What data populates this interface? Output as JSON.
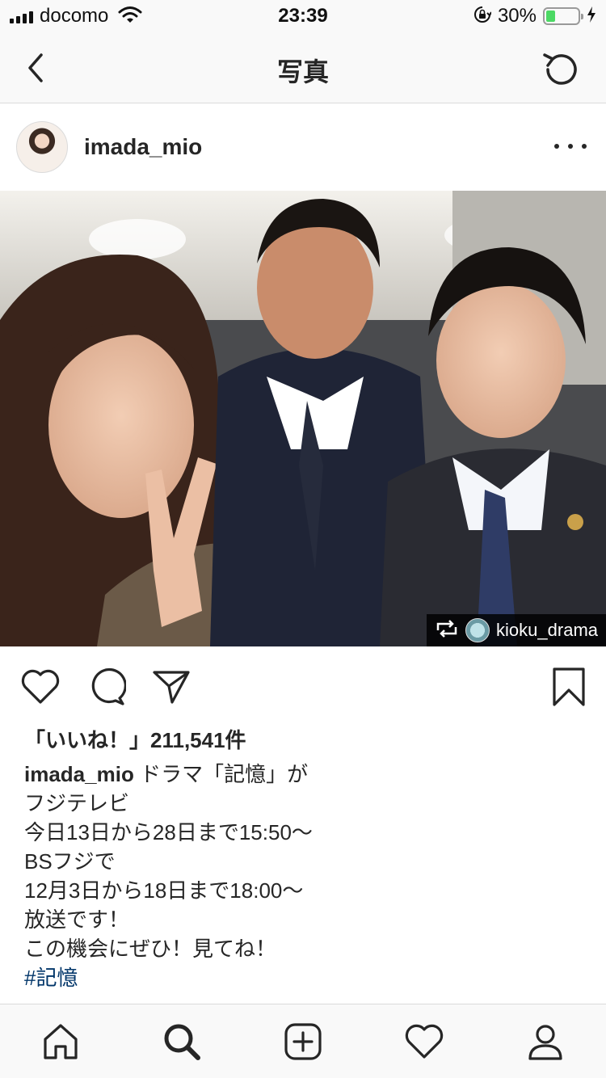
{
  "status_bar": {
    "carrier": "docomo",
    "time": "23:39",
    "battery_percent": "30%",
    "battery_level": 0.3,
    "icons": [
      "signal-icon",
      "wifi-icon",
      "orientation-lock-icon",
      "battery-icon",
      "charging-icon"
    ]
  },
  "nav": {
    "title": "写真",
    "back_icon": "chevron-left-icon",
    "refresh_icon": "refresh-icon"
  },
  "post": {
    "username": "imada_mio",
    "more_icon": "ellipsis-icon",
    "repost_username": "kioku_drama",
    "likes_label": "「いいね！」211,541件",
    "caption_username": "imada_mio",
    "caption_lines": [
      "ドラマ「記憶」が",
      "フジテレビ",
      "今日13日から28日まで15:50〜",
      "BSフジで",
      "12月3日から18日まで18:00〜",
      "放送です！",
      "この機会にぜひ！見てね！"
    ],
    "hashtag": "#記憶"
  },
  "actions": [
    "heart-icon",
    "comment-icon",
    "share-icon",
    "bookmark-icon"
  ],
  "tabbar": [
    "home-icon",
    "search-icon",
    "add-post-icon",
    "activity-heart-icon",
    "profile-icon"
  ],
  "colors": {
    "bar_background": "#f9f9f9",
    "text": "#262626",
    "hashtag": "#003569",
    "battery_fill": "#4cd964"
  }
}
